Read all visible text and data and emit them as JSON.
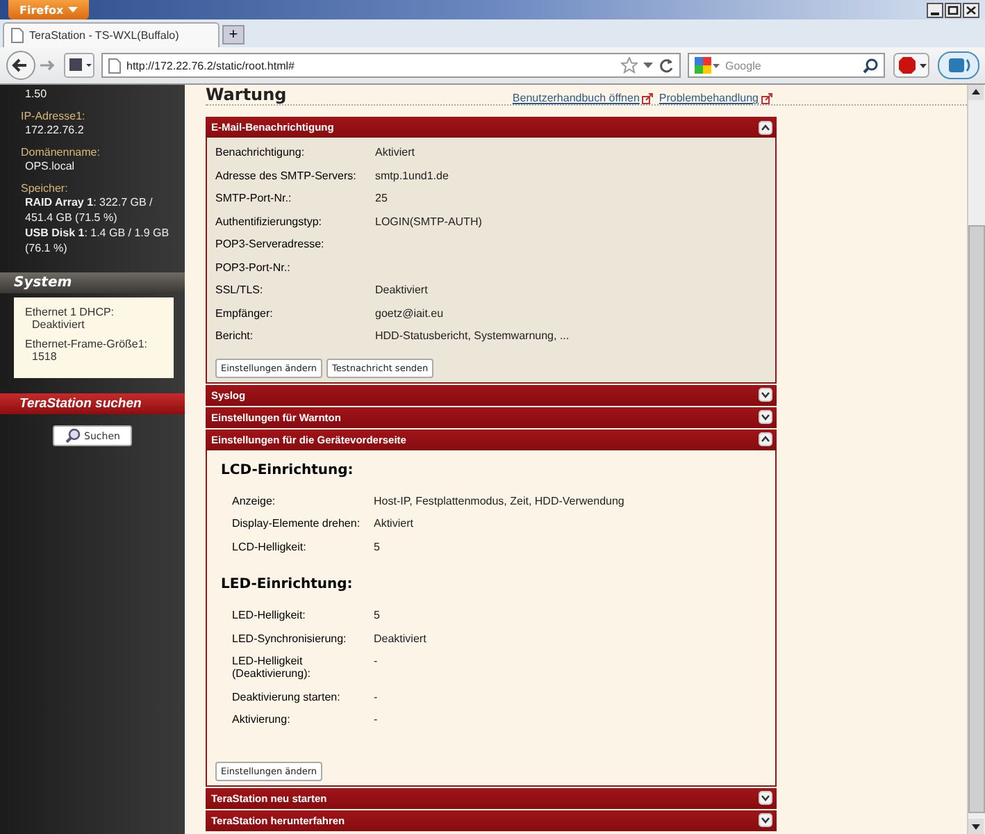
{
  "browser": {
    "menu_button": "Firefox",
    "tab_title": "TeraStation - TS-WXL(Buffalo)",
    "new_tab": "+",
    "url": "http://172.22.76.2/static/root.html#",
    "search_placeholder": "Google"
  },
  "sidebar": {
    "info": [
      {
        "values": [
          "1.50"
        ]
      },
      {
        "label": "IP-Adresse1:",
        "values": [
          "172.22.76.2"
        ]
      },
      {
        "label": "Domänenname:",
        "values": [
          "OPS.local"
        ]
      },
      {
        "label": "Speicher:",
        "values": [
          "**RAID Array 1**: 322.7 GB / 451.4 GB (71.5 %)",
          "**USB Disk 1**: 1.4 GB / 1.9 GB (76.1 %)"
        ]
      }
    ],
    "system_title": "System",
    "system": [
      {
        "label": "Ethernet 1 DHCP:",
        "value": "Deaktiviert"
      },
      {
        "label": "Ethernet-Frame-Größe1:",
        "value": "1518"
      }
    ],
    "search_title": "TeraStation suchen",
    "search_button": "Suchen"
  },
  "page": {
    "title": "Wartung",
    "links": [
      "Benutzerhandbuch öffnen",
      "Problembehandlung"
    ]
  },
  "sections": [
    {
      "title": "E-Mail-Benachrichtigung",
      "expanded": true,
      "groups": [
        {
          "rows": [
            {
              "label": "Benachrichtigung:",
              "value": "Aktiviert"
            },
            {
              "label": "Adresse des SMTP-Servers:",
              "value": "smtp.1und1.de"
            },
            {
              "label": "SMTP-Port-Nr.:",
              "value": "25"
            },
            {
              "label": "Authentifizierungstyp:",
              "value": "LOGIN(SMTP-AUTH)"
            },
            {
              "label": "POP3-Serveradresse:"
            },
            {
              "label": "POP3-Port-Nr.:"
            },
            {
              "label": "SSL/TLS:",
              "value": "Deaktiviert"
            },
            {
              "label": "Empfänger:",
              "value": "goetz@iait.eu"
            },
            {
              "label": "Bericht:",
              "value": "HDD-Statusbericht, Systemwarnung, ..."
            }
          ]
        }
      ],
      "buttons": [
        "Einstellungen ändern",
        "Testnachricht senden"
      ]
    },
    {
      "title": "Syslog",
      "expanded": false
    },
    {
      "title": "Einstellungen für Warnton",
      "expanded": false
    },
    {
      "title": "Einstellungen für die Gerätevorderseite",
      "expanded": true,
      "groups": [
        {
          "heading": "LCD-Einrichtung:",
          "rows": [
            {
              "label": "Anzeige:",
              "value": "Host-IP, Festplattenmodus, Zeit, HDD-Verwendung"
            },
            {
              "label": "Display-Elemente drehen:",
              "value": "Aktiviert"
            },
            {
              "label": "LCD-Helligkeit:",
              "value": "5"
            }
          ]
        },
        {
          "heading": "LED-Einrichtung:",
          "rows": [
            {
              "label": "LED-Helligkeit:",
              "value": "5"
            },
            {
              "label": "LED-Synchronisierung:",
              "value": "Deaktiviert"
            },
            {
              "label": "LED-Helligkeit (Deaktivierung):",
              "value": "-"
            },
            {
              "label": "Deaktivierung starten:",
              "value": "-"
            },
            {
              "label": "Aktivierung:",
              "value": "-"
            }
          ]
        }
      ],
      "buttons": [
        "Einstellungen ändern"
      ]
    },
    {
      "title": "TeraStation neu starten",
      "expanded": false
    },
    {
      "title": "TeraStation herunterfahren",
      "expanded": false
    }
  ]
}
